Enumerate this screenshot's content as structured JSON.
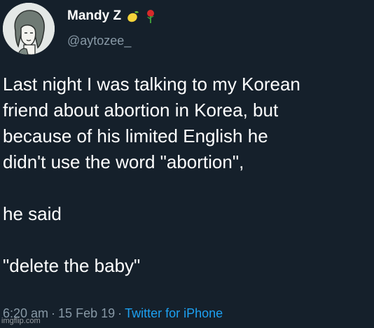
{
  "author": {
    "display_name": "Mandy Z",
    "handle": "@aytozee_",
    "name_emojis": [
      "lemon-icon",
      "rose-icon"
    ]
  },
  "tweet": {
    "lines": [
      "Last night I was talking to my Korean",
      "friend about abortion in Korea, but",
      "because of his limited English he",
      "didn't use the word \"abortion\",",
      "",
      "he said",
      "",
      "\"delete the baby\""
    ]
  },
  "meta": {
    "time": "6:20 am",
    "separator": "·",
    "date": "15 Feb 19",
    "source": "Twitter for iPhone"
  },
  "watermark": "imgflip.com",
  "colors": {
    "background": "#15202b",
    "text": "#ffffff",
    "secondary": "#8899a6",
    "link": "#1da1f2"
  }
}
